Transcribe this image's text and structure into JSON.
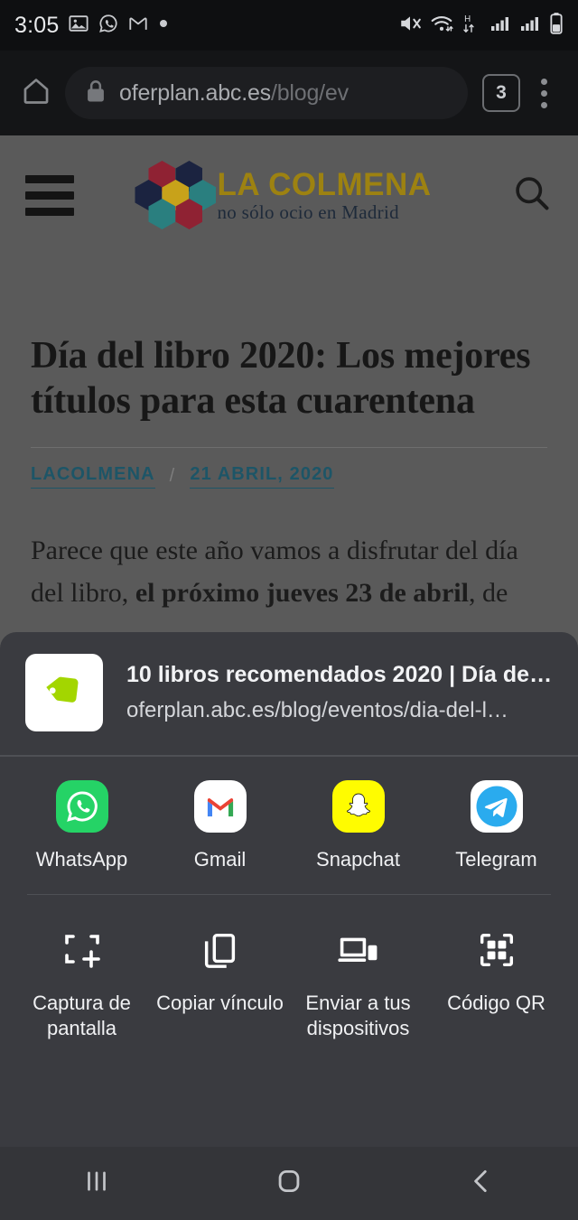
{
  "status_bar": {
    "time": "3:05",
    "notification_icons": [
      "photos-icon",
      "whatsapp-icon",
      "gmail-icon",
      "dot-icon"
    ],
    "system_icons": [
      "mute-icon",
      "wifi-icon",
      "hspa-data-icon",
      "signal-sim1-icon",
      "signal-sim2-icon",
      "battery-icon"
    ]
  },
  "browser": {
    "home_label": "home-icon",
    "url_host": "oferplan.abc.es",
    "url_path": "/blog/ev",
    "url_full": "oferplan.abc.es/blog/ev",
    "tab_count": "3",
    "menu_label": "more-options"
  },
  "page": {
    "brand_title": "LA COLMENA",
    "brand_tagline": "no sólo ocio en Madrid",
    "brand_title_color": "#9d8211",
    "brand_tagline_color": "#1e2a3a",
    "hex_colors": [
      "#8f2233",
      "#1b2340",
      "#1b2340",
      "#c8a21a",
      "#2a7f7f",
      "#2a7f7f",
      "#8f2233"
    ],
    "article_title": "Día del libro 2020: Los mejores títulos para esta cuarentena",
    "author": "LACOLMENA",
    "separator": "/",
    "date": "21 ABRIL, 2020",
    "body_part1": "Parece que este año vamos a disfrutar del día del libro, ",
    "body_bold": "el próximo jueves 23 de abril",
    "body_part2": ", de"
  },
  "share_sheet": {
    "preview_title": "10 libros recomendados 2020 | Día del…",
    "preview_url": "oferplan.abc.es/blog/eventos/dia-del-l…",
    "preview_thumb_icon": "price-tag-icon",
    "apps": [
      {
        "label": "WhatsApp",
        "icon": "whatsapp-icon",
        "color": "#25D366"
      },
      {
        "label": "Gmail",
        "icon": "gmail-icon",
        "color": "#FFFFFF"
      },
      {
        "label": "Snapchat",
        "icon": "snapchat-icon",
        "color": "#FFFC00"
      },
      {
        "label": "Telegram",
        "icon": "telegram-icon",
        "color": "#2AABEE"
      }
    ],
    "actions": [
      {
        "label": "Captura de pantalla",
        "icon": "screenshot-icon"
      },
      {
        "label": "Copiar vínculo",
        "icon": "copy-link-icon"
      },
      {
        "label": "Enviar a tus dispositivos",
        "icon": "send-to-devices-icon"
      },
      {
        "label": "Código QR",
        "icon": "qr-code-icon"
      }
    ]
  },
  "nav_bar": {
    "recents": "recents-icon",
    "home": "home-icon",
    "back": "back-icon"
  }
}
